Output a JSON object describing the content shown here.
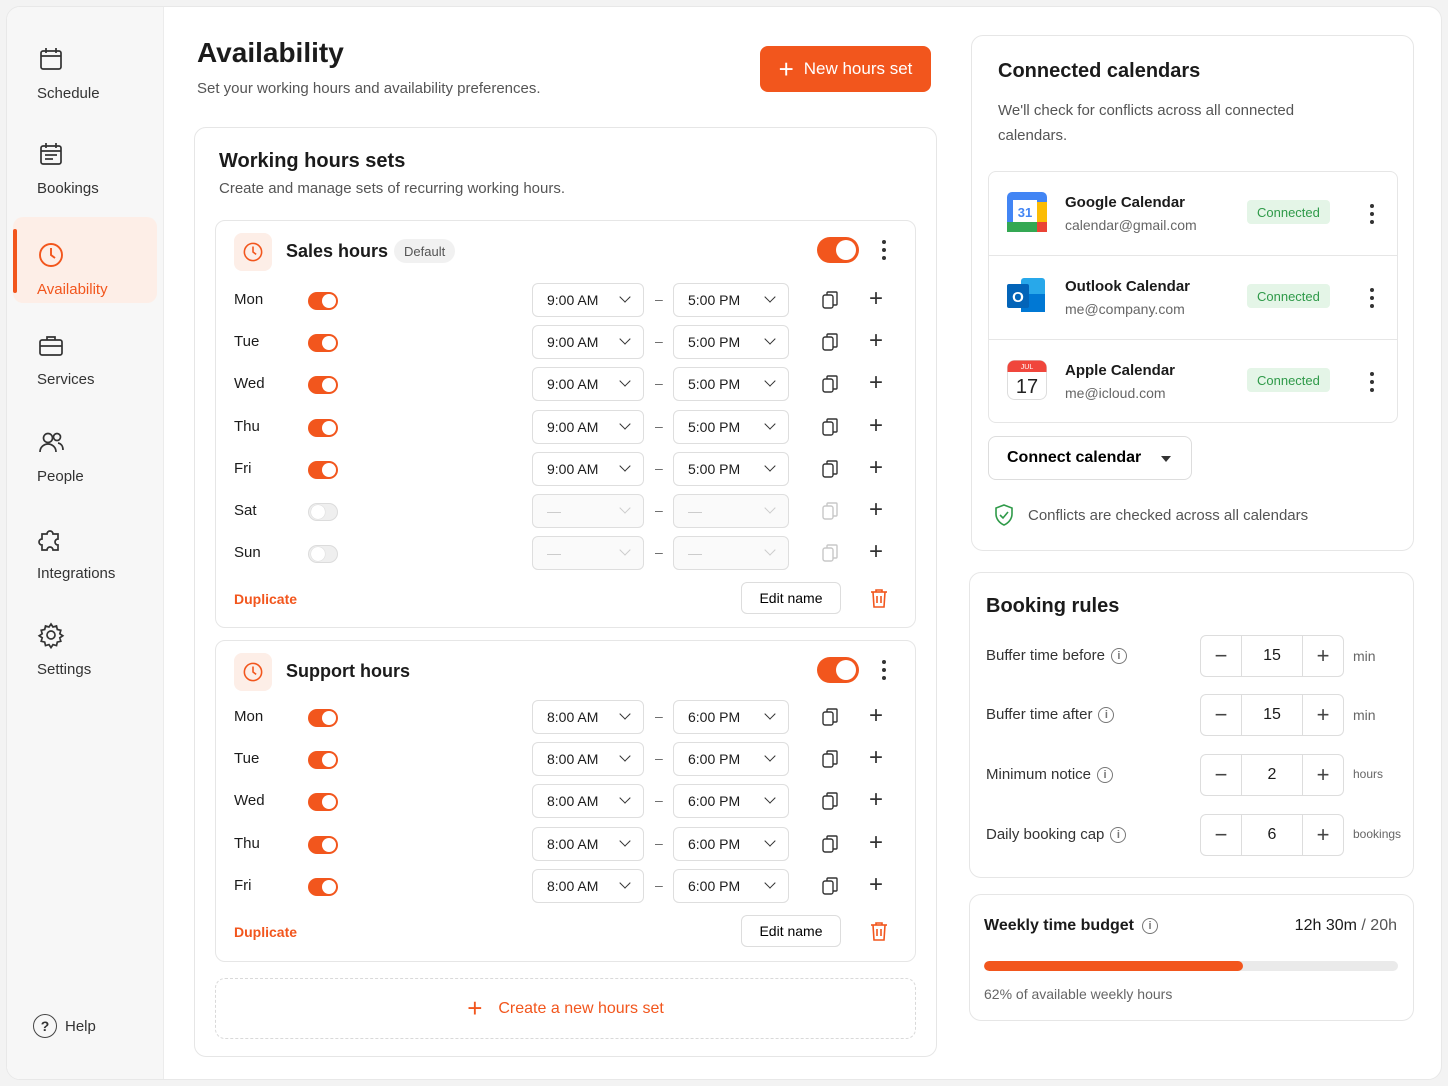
{
  "sidebar": {
    "items": [
      {
        "label": "Schedule",
        "icon": "calendar-icon",
        "active": false
      },
      {
        "label": "Bookings",
        "icon": "calendar-list-icon",
        "active": false
      },
      {
        "label": "Availability",
        "icon": "clock-icon",
        "active": true
      },
      {
        "label": "Services",
        "icon": "briefcase-icon",
        "active": false
      },
      {
        "label": "People",
        "icon": "people-icon",
        "active": false
      },
      {
        "label": "Integrations",
        "icon": "puzzle-icon",
        "active": false
      },
      {
        "label": "Settings",
        "icon": "gear-icon",
        "active": false
      }
    ],
    "help_label": "Help",
    "help_icon": "?"
  },
  "header": {
    "title": "Availability",
    "subtitle": "Set your working hours and availability preferences.",
    "new_button_label": "New hours set"
  },
  "working_hours": {
    "title": "Working hours sets",
    "subtitle": "Create and manage sets of recurring working hours.",
    "sets": [
      {
        "name": "Sales hours",
        "badge": "Default",
        "enabled": true,
        "days": [
          {
            "day": "Mon",
            "on": true,
            "start": "9:00 AM",
            "end": "5:00 PM"
          },
          {
            "day": "Tue",
            "on": true,
            "start": "9:00 AM",
            "end": "5:00 PM"
          },
          {
            "day": "Wed",
            "on": true,
            "start": "9:00 AM",
            "end": "5:00 PM"
          },
          {
            "day": "Thu",
            "on": true,
            "start": "9:00 AM",
            "end": "5:00 PM"
          },
          {
            "day": "Fri",
            "on": true,
            "start": "9:00 AM",
            "end": "5:00 PM"
          },
          {
            "day": "Sat",
            "on": false,
            "start": "—",
            "end": "—"
          },
          {
            "day": "Sun",
            "on": false,
            "start": "—",
            "end": "—"
          }
        ],
        "duplicate_label": "Duplicate",
        "edit_label": "Edit name"
      },
      {
        "name": "Support hours",
        "badge": "",
        "enabled": true,
        "days": [
          {
            "day": "Mon",
            "on": true,
            "start": "8:00 AM",
            "end": "6:00 PM"
          },
          {
            "day": "Tue",
            "on": true,
            "start": "8:00 AM",
            "end": "6:00 PM"
          },
          {
            "day": "Wed",
            "on": true,
            "start": "8:00 AM",
            "end": "6:00 PM"
          },
          {
            "day": "Thu",
            "on": true,
            "start": "8:00 AM",
            "end": "6:00 PM"
          },
          {
            "day": "Fri",
            "on": true,
            "start": "8:00 AM",
            "end": "6:00 PM"
          }
        ],
        "duplicate_label": "Duplicate",
        "edit_label": "Edit name"
      }
    ],
    "create_label": "Create a new hours set",
    "range_separator": "–"
  },
  "connected_calendars": {
    "title": "Connected calendars",
    "subtitle": "We'll check for conflicts across all connected calendars.",
    "items": [
      {
        "name": "Google Calendar",
        "email": "calendar@gmail.com",
        "status": "Connected",
        "icon": "google-calendar-icon",
        "icon_text": "31"
      },
      {
        "name": "Outlook Calendar",
        "email": "me@company.com",
        "status": "Connected",
        "icon": "outlook-icon",
        "icon_text": "O"
      },
      {
        "name": "Apple Calendar",
        "email": "me@icloud.com",
        "status": "Connected",
        "icon": "apple-calendar-icon",
        "icon_month": "JUL",
        "icon_text": "17"
      }
    ],
    "connect_button_label": "Connect calendar",
    "note": "Conflicts are checked across all calendars"
  },
  "booking_rules": {
    "title": "Booking rules",
    "rules": [
      {
        "label": "Buffer time before",
        "value": "15",
        "unit": "min"
      },
      {
        "label": "Buffer time after",
        "value": "15",
        "unit": "min"
      },
      {
        "label": "Minimum notice",
        "value": "2",
        "unit": "hours"
      },
      {
        "label": "Daily booking cap",
        "value": "6",
        "unit": "bookings"
      }
    ],
    "minus": "−",
    "plus": "+"
  },
  "weekly_budget": {
    "title": "Weekly time budget",
    "used": "12h 30m",
    "separator": "/",
    "total": "20h",
    "progress_fraction": 0.625,
    "note": "62% of available weekly hours"
  },
  "colors": {
    "accent": "#f2561d",
    "connected_bg": "#e4f5e7",
    "connected_text": "#2f9a49"
  }
}
